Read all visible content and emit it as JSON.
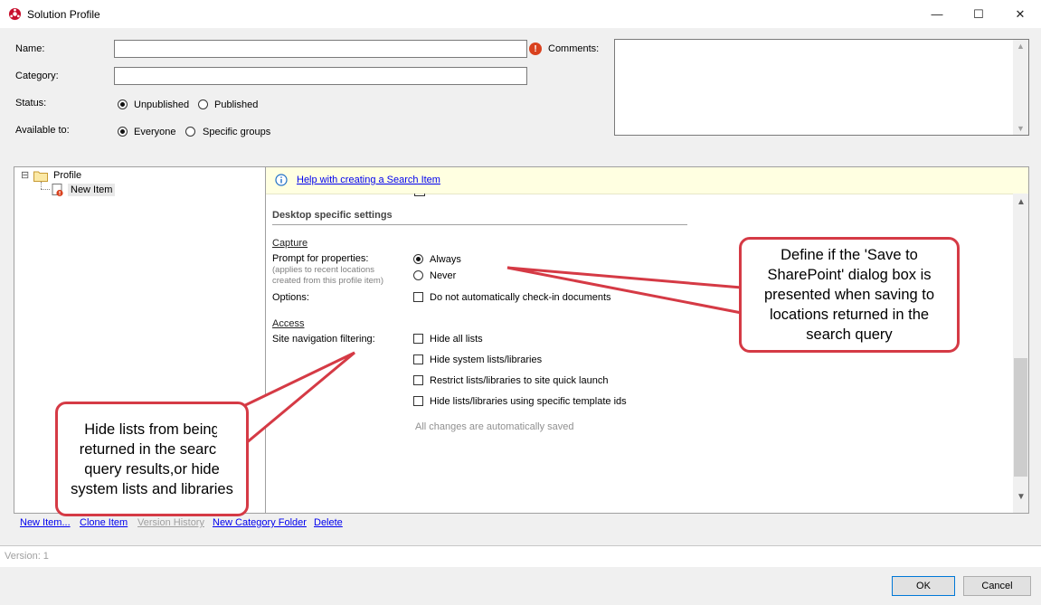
{
  "window": {
    "title": "Solution Profile",
    "minimize_glyph": "—",
    "maximize_glyph": "☐",
    "close_glyph": "✕"
  },
  "form": {
    "name_label": "Name:",
    "name_value": "",
    "error_glyph": "!",
    "comments_label": "Comments:",
    "comments_value": "",
    "category_label": "Category:",
    "category_value": "",
    "status_label": "Status:",
    "status_options": [
      "Unpublished",
      "Published"
    ],
    "status_selected": "Unpublished",
    "available_label": "Available to:",
    "available_options": [
      "Everyone",
      "Specific groups"
    ],
    "available_selected": "Everyone"
  },
  "tree": {
    "expander": "⊟",
    "root_label": "Profile",
    "child_label": "New Item"
  },
  "content": {
    "help_link": "Help with creating a Search Item",
    "section_title": "Desktop specific settings",
    "capture_heading": "Capture",
    "prompt_label": "Prompt for properties:",
    "prompt_note": "(applies to recent locations created from this profile item)",
    "prompt_options": [
      "Always",
      "Never"
    ],
    "prompt_selected": "Always",
    "options_label": "Options:",
    "options_checkbox": "Do not automatically check-in documents",
    "access_heading": "Access",
    "site_nav_label": "Site navigation filtering:",
    "site_nav_options": [
      "Hide all lists",
      "Hide system lists/libraries",
      "Restrict lists/libraries to site quick launch",
      "Hide lists/libraries using specific template ids"
    ],
    "autosave_note": "All changes are automatically saved"
  },
  "callouts": {
    "right": "Define if the 'Save to SharePoint' dialog box is presented when saving to locations returned in the search query",
    "left": "Hide lists from being returned in the search query results,or hide system lists and libraries"
  },
  "actions": {
    "new_item": "New Item...",
    "clone_item": "Clone Item",
    "version_history": "Version History",
    "new_category_folder": "New Category Folder",
    "delete": "Delete"
  },
  "footer": {
    "version": "Version: 1",
    "ok": "OK",
    "cancel": "Cancel"
  },
  "colors": {
    "callout_border": "#d53a45",
    "link": "#0000ee",
    "help_bar": "#ffffe1"
  }
}
